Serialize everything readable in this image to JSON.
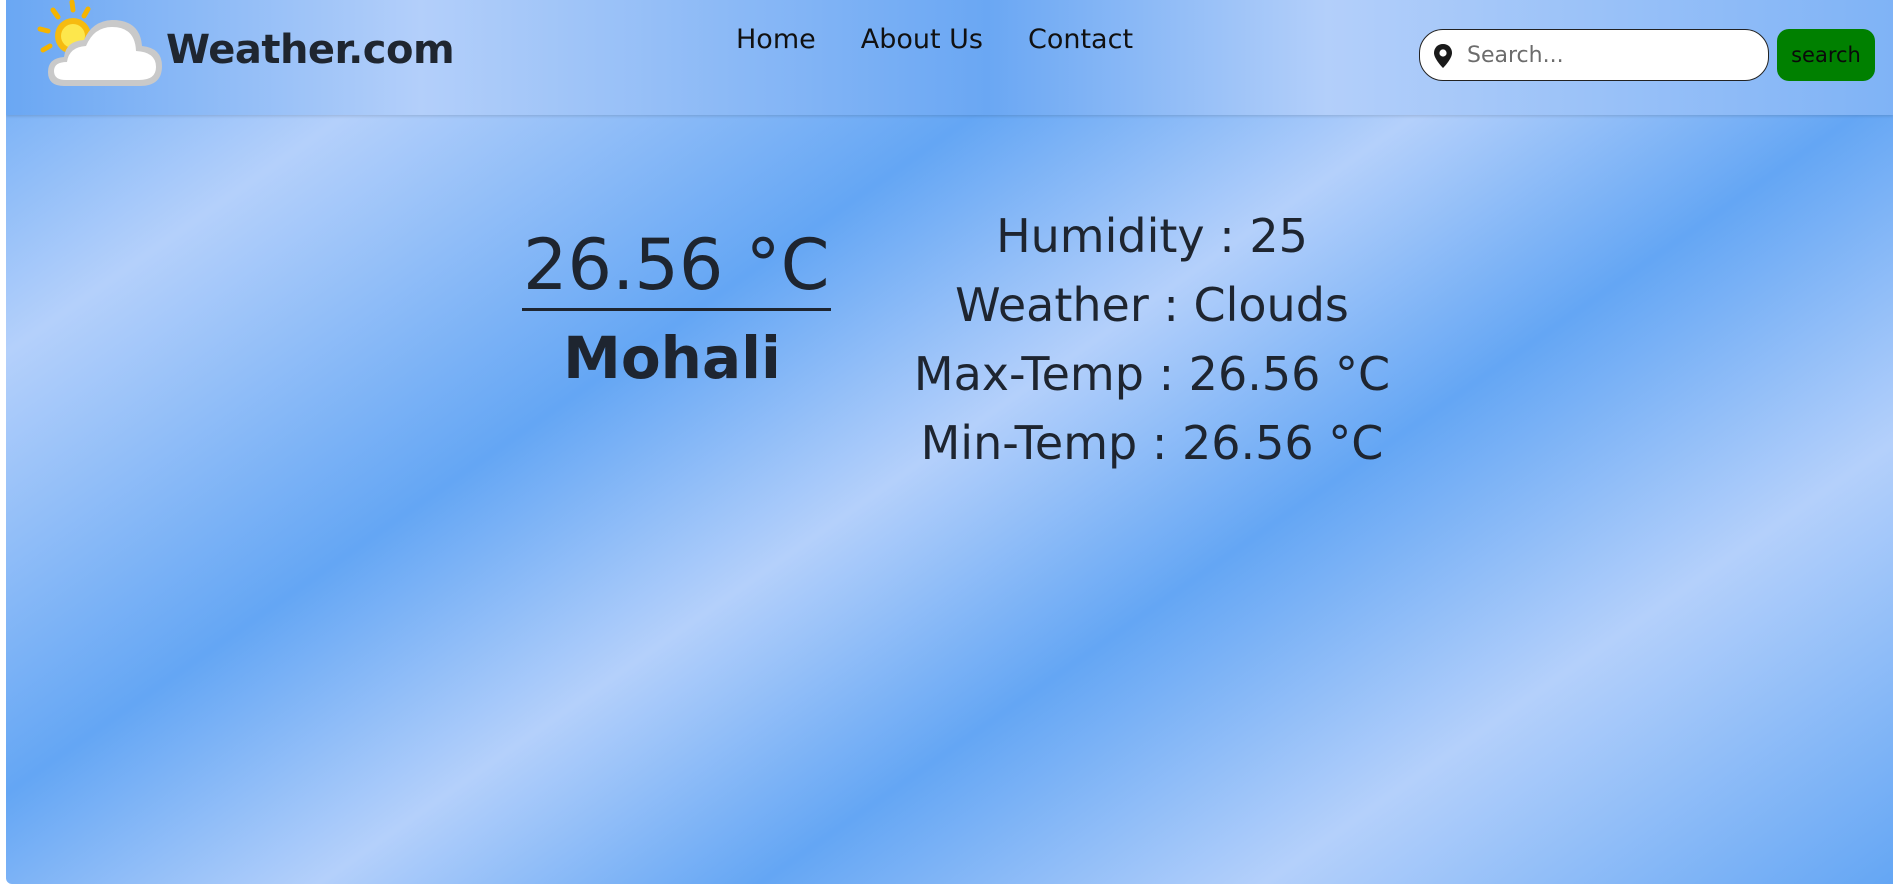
{
  "header": {
    "brand_name": "Weather.com",
    "nav": [
      {
        "label": "Home"
      },
      {
        "label": "About Us"
      },
      {
        "label": "Contact"
      }
    ],
    "search": {
      "placeholder": "Search...",
      "value": "",
      "button_label": "search"
    }
  },
  "weather": {
    "temperature": "26.56 °C",
    "city": "Mohali",
    "humidity": "Humidity : 25",
    "condition": "Weather : Clouds",
    "max_temp": "Max-Temp : 26.56 °C",
    "min_temp": "Min-Temp : 26.56 °C"
  },
  "icons": {
    "brand_logo": "sun-behind-cloud-icon",
    "search_field": "location-pin-icon"
  },
  "colors": {
    "search_button": "#008000",
    "background_dark": "#64a6f4",
    "background_light": "#b4d0fb",
    "text": "#1e2530"
  }
}
